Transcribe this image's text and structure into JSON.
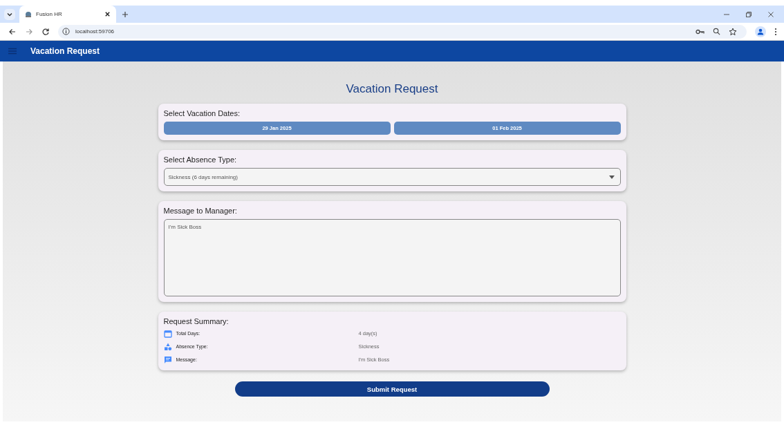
{
  "browser": {
    "tab_title": "Fusion HR",
    "address": "localhost:59706"
  },
  "app_bar": {
    "title": "Vacation Request"
  },
  "page_title": "Vacation Request",
  "dates": {
    "heading": "Select Vacation Dates:",
    "start": "29 Jan 2025",
    "end": "01 Feb 2025"
  },
  "absence": {
    "heading": "Select Absence Type:",
    "value": "Sickness (6 days remaining)"
  },
  "message": {
    "heading": "Message to Manager:",
    "value": "I'm Sick Boss"
  },
  "summary": {
    "heading": "Request Summary:",
    "rows": [
      {
        "kind": "calendar",
        "label": "Total Days:",
        "value": "4 day(s)"
      },
      {
        "kind": "shapes",
        "label": "Absence Type:",
        "value": "Sickness"
      },
      {
        "kind": "chat",
        "label": "Message:",
        "value": "I'm Sick Boss"
      }
    ]
  },
  "submit": "Submit Request"
}
